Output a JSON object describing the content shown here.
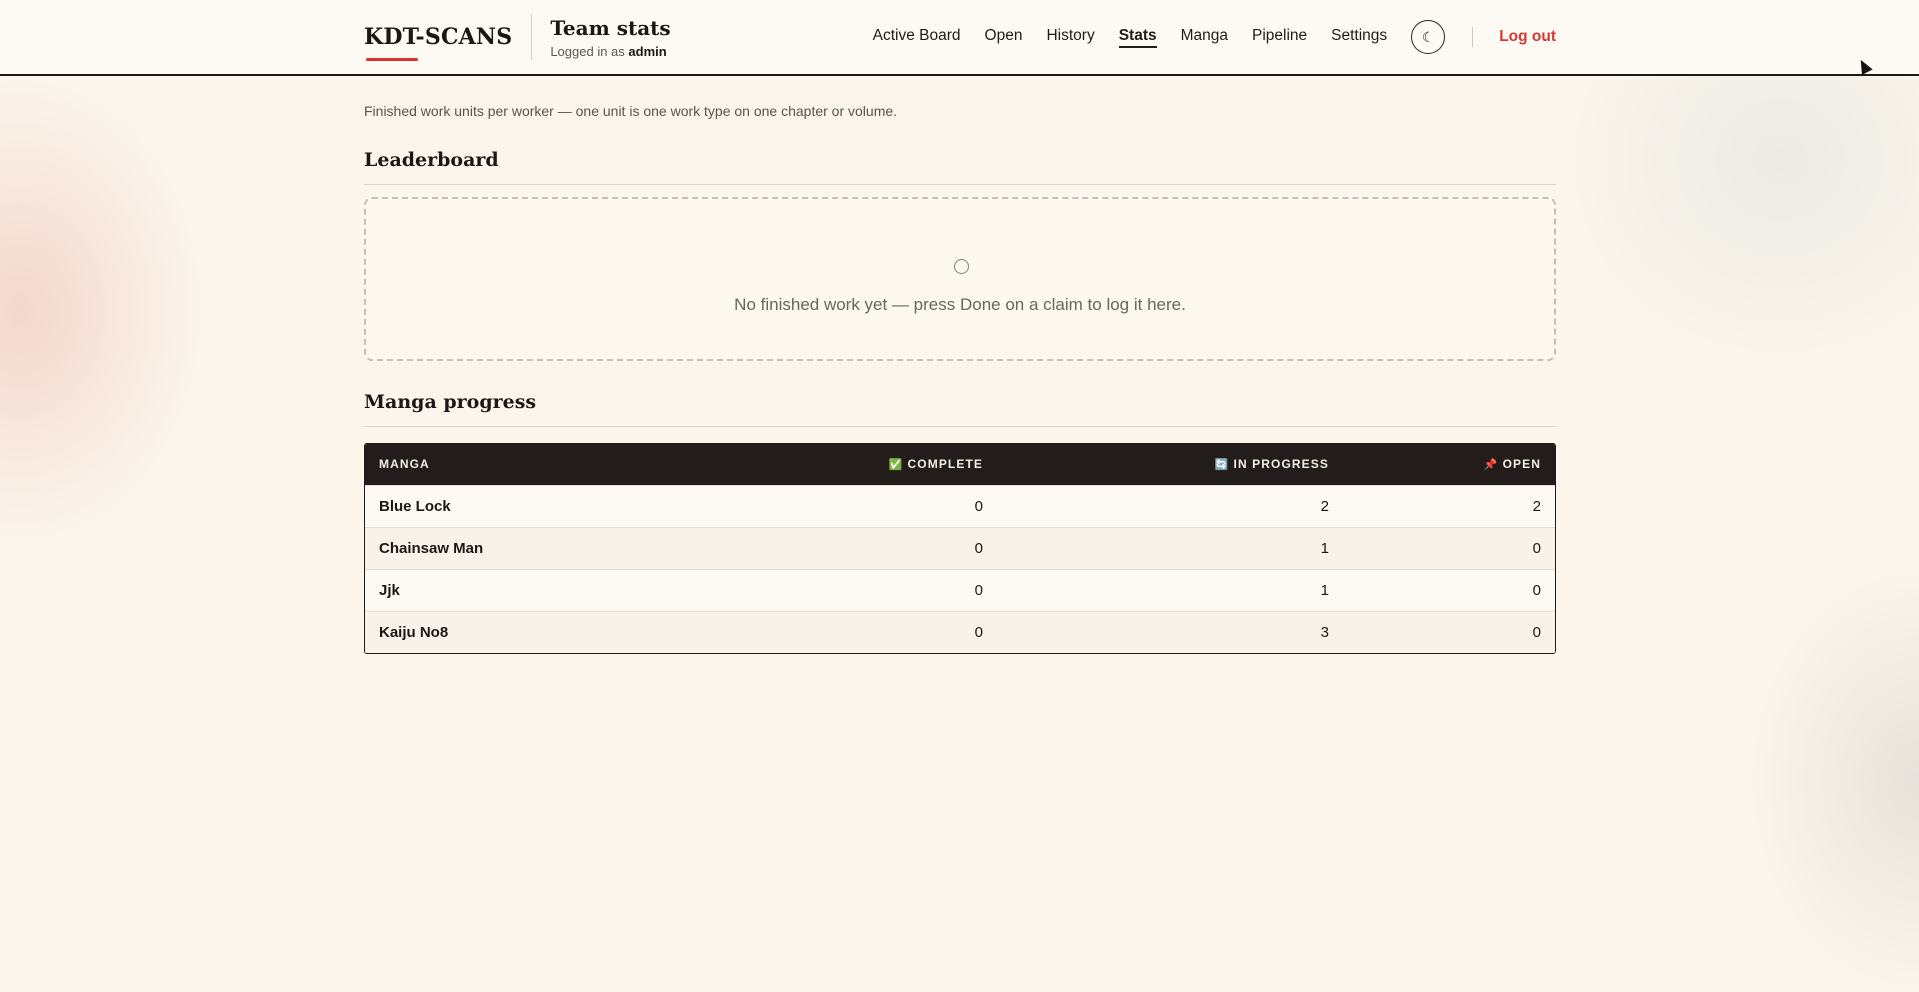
{
  "brand": "KDT-SCANS",
  "page": {
    "title": "Team stats",
    "login_prefix": "Logged in as",
    "login_user": "admin"
  },
  "nav": {
    "items": [
      {
        "label": "Active Board"
      },
      {
        "label": "Open"
      },
      {
        "label": "History"
      },
      {
        "label": "Stats",
        "active": true
      },
      {
        "label": "Manga"
      },
      {
        "label": "Pipeline"
      },
      {
        "label": "Settings"
      }
    ],
    "theme_icon": "☾",
    "logout_label": "Log out"
  },
  "intro": "Finished work units per worker — one unit is one work type on one chapter or volume.",
  "leaderboard": {
    "title": "Leaderboard",
    "empty_message": "No finished work yet — press Done on a claim to log it here."
  },
  "manga_progress": {
    "title": "Manga progress",
    "columns": [
      {
        "emoji": "",
        "label": "MANGA"
      },
      {
        "emoji": "✅",
        "label": "COMPLETE"
      },
      {
        "emoji": "🔄",
        "label": "IN PROGRESS"
      },
      {
        "emoji": "📌",
        "label": "OPEN"
      }
    ],
    "rows": [
      {
        "manga": "Blue Lock",
        "complete": "0",
        "in_progress": "2",
        "open": "2"
      },
      {
        "manga": "Chainsaw Man",
        "complete": "0",
        "in_progress": "1",
        "open": "0"
      },
      {
        "manga": "Jjk",
        "complete": "0",
        "in_progress": "1",
        "open": "0"
      },
      {
        "manga": "Kaiju No8",
        "complete": "0",
        "in_progress": "3",
        "open": "0"
      }
    ]
  },
  "colors": {
    "accent": "#d9332b",
    "logout": "#d43a31",
    "table_header_bg": "#221d1a",
    "page_bg": "#fbf5ec"
  }
}
